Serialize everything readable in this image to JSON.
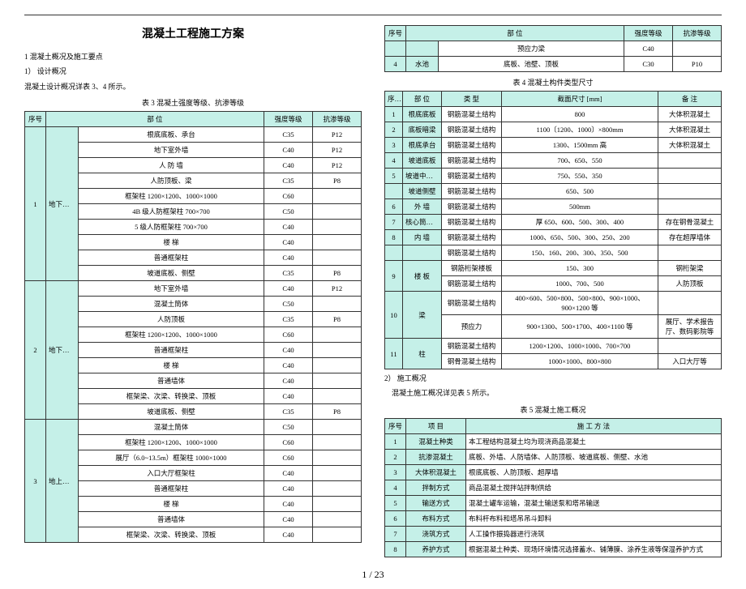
{
  "title": "混凝土工程施工方案",
  "intro": {
    "h1": "1  混凝土概况及施工要点",
    "h2": "1）  设计概况",
    "p1": "混凝土设计概况详表 3、4 所示。"
  },
  "table3": {
    "caption": "表 3    混凝土强度等级、抗渗等级",
    "headers": [
      "序号",
      "部       位",
      "强度等级",
      "抗渗等级"
    ],
    "groups": [
      {
        "num": "1",
        "section": "地下二层",
        "rows": [
          [
            "根底底板、承台",
            "C35",
            "P12"
          ],
          [
            "地下室外墙",
            "C40",
            "P12"
          ],
          [
            "人   防   墙",
            "C40",
            "P12"
          ],
          [
            "人防顶板、梁",
            "C35",
            "P8"
          ],
          [
            "框架柱 1200×1200、1000×1000",
            "C60",
            ""
          ],
          [
            "4B 级人防框架柱 700×700",
            "C50",
            ""
          ],
          [
            "5 级人防框架柱 700×700",
            "C40",
            ""
          ],
          [
            "楼        梯",
            "C40",
            ""
          ],
          [
            "普通框架柱",
            "C40",
            ""
          ],
          [
            "坡道底板、侧壁",
            "C35",
            "P8"
          ]
        ]
      },
      {
        "num": "2",
        "section": "地下一层",
        "rows": [
          [
            "地下室外墙",
            "C40",
            "P12"
          ],
          [
            "混凝土筒体",
            "C50",
            ""
          ],
          [
            "人防顶板",
            "C35",
            "P8"
          ],
          [
            "框架柱 1200×1200、1000×1000",
            "C60",
            ""
          ],
          [
            "普通框架柱",
            "C40",
            ""
          ],
          [
            "楼        梯",
            "C40",
            ""
          ],
          [
            "普通墙体",
            "C40",
            ""
          ],
          [
            "框架梁、次梁、转换梁、顶板",
            "C40",
            ""
          ],
          [
            "坡道底板、侧壁",
            "C35",
            "P8"
          ]
        ]
      },
      {
        "num": "3",
        "section": "地上结构",
        "rows": [
          [
            "混凝土筒体",
            "C50",
            ""
          ],
          [
            "框架柱 1200×1200、1000×1000",
            "C60",
            ""
          ],
          [
            "展厅（6.0~13.5m）框架柱 1000×1000",
            "C60",
            ""
          ],
          [
            "入口大厅框架柱",
            "C40",
            ""
          ],
          [
            "普通框架柱",
            "C40",
            ""
          ],
          [
            "楼        梯",
            "C40",
            ""
          ],
          [
            "普通墙体",
            "C40",
            ""
          ],
          [
            "框架梁、次梁、转换梁、顶板",
            "C40",
            ""
          ]
        ]
      }
    ]
  },
  "table3b": {
    "headers": [
      "序号",
      "部       位",
      "强度等级",
      "抗渗等级"
    ],
    "rows": [
      [
        "",
        "",
        "预应力梁",
        "C40",
        ""
      ],
      [
        "4",
        "水池",
        "底板、池壁、顶板",
        "C30",
        "P10"
      ]
    ]
  },
  "table4": {
    "caption": "表 4    混凝土构件类型尺寸",
    "headers": [
      "序号",
      "部    位",
      "类    型",
      "截面尺寸 [mm]",
      "备    注"
    ],
    "rows": [
      [
        "1",
        "根底底板",
        "钢筋混凝土结构",
        "800",
        "大体积混凝土"
      ],
      [
        "2",
        "底板暗梁",
        "钢筋混凝土结构",
        "1100〔1200、1000〕×800mm",
        "大体积混凝土"
      ],
      [
        "3",
        "根底承台",
        "钢筋混凝土结构",
        "1300、1500mm 高",
        "大体积混凝土"
      ],
      [
        "4",
        "坡道底板",
        "钢筋混凝土结构",
        "700、650、550",
        ""
      ],
      [
        "5",
        "坡道中间板",
        "钢筋混凝土结构",
        "750、550、350",
        ""
      ],
      [
        "",
        "坡道侧壁",
        "钢筋混凝土结构",
        "650、500",
        ""
      ],
      [
        "6",
        "外    墙",
        "钢筋混凝土结构",
        "500mm",
        ""
      ],
      [
        "7",
        "核心筒墙体",
        "钢筋混凝土结构",
        "厚 650、600、500、300、400",
        "存在钢骨混凝土"
      ],
      [
        "8",
        "内    墙",
        "钢筋混凝土结构",
        "1000、650、500、300、250、200",
        "存在超厚墙体"
      ],
      [
        "",
        "",
        "钢筋混凝土结构",
        "150、160、200、300、350、500",
        ""
      ]
    ],
    "group9": {
      "num": "9",
      "section": "楼    板",
      "rows": [
        [
          "钢筋桁架楼板",
          "150、300",
          "钢桁架梁"
        ],
        [
          "钢筋混凝土结构",
          "1000、700、500",
          "人防顶板"
        ]
      ]
    },
    "group10": {
      "num": "10",
      "section": "梁",
      "rows": [
        [
          "钢筋混凝土结构",
          "400×600、500×800、500×800、900×1000、900×1200 等",
          ""
        ],
        [
          "预应力",
          "900×1300、500×1700、400×1100 等",
          "展厅、学术报告厅、数码影院等"
        ]
      ]
    },
    "group11": {
      "num": "11",
      "section": "柱",
      "rows": [
        [
          "钢筋混凝土结构",
          "1200×1200、1000×1000、700×700",
          ""
        ],
        [
          "钢骨混凝土结构",
          "1000×1000、800×800",
          "入口大厅等"
        ]
      ]
    }
  },
  "constr": {
    "h": "2）  施工概况",
    "p": "混凝土施工概况详见表 5 所示。"
  },
  "table5": {
    "caption": "表 5    混凝土施工概况",
    "headers": [
      "序号",
      "项       目",
      "施 工 方 法"
    ],
    "rows": [
      [
        "1",
        "混凝土种类",
        "本工程结构混凝土均为现浇商品混凝土"
      ],
      [
        "2",
        "抗渗混凝土",
        "底板、外墙、人防墙体、人防顶板、坡道底板、侧壁、水池"
      ],
      [
        "3",
        "大体积混凝土",
        "根底底板、人防顶板、超厚墙"
      ],
      [
        "4",
        "拌制方式",
        "商品混凝土搅拌站拌制供给"
      ],
      [
        "5",
        "输送方式",
        "混凝土罐车运输，混凝土输送泵和塔吊输送"
      ],
      [
        "6",
        "布料方式",
        "布料杆布料和塔吊吊斗卸料"
      ],
      [
        "7",
        "浇筑方式",
        "人工操作振捣器进行浇筑"
      ],
      [
        "8",
        "养护方式",
        "根据混凝土种类、现场环境情况选择蓄水、铺薄膜、涂养生液等保湿养护方式"
      ]
    ]
  },
  "pagenum": "1 / 23"
}
